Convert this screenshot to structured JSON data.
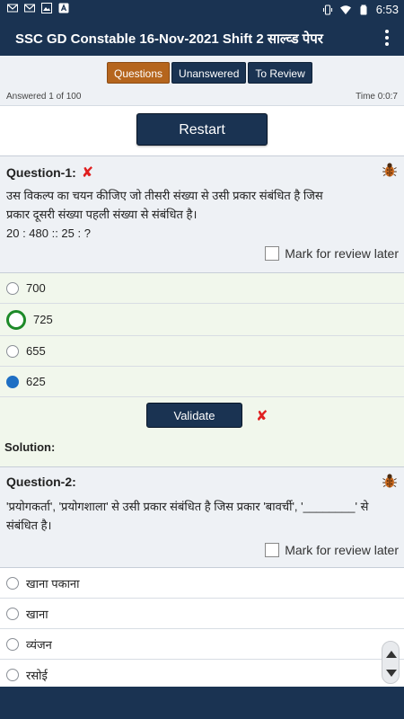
{
  "status_bar": {
    "time": "6:53",
    "left_icons": [
      "gmail-icon",
      "gmail-icon",
      "image-icon",
      "app-icon"
    ],
    "right_icons": [
      "vibrate-icon",
      "wifi-icon",
      "battery-icon"
    ]
  },
  "app_bar": {
    "title": "SSC GD Constable 16-Nov-2021 Shift 2 साल्व्ड पेपर",
    "menu_icon": "more-vert-icon"
  },
  "tabs": [
    {
      "label": "Questions",
      "active": true
    },
    {
      "label": "Unanswered",
      "active": false
    },
    {
      "label": "To Review",
      "active": false
    }
  ],
  "info": {
    "answered": "Answered 1 of 100",
    "time": "Time 0:0:7"
  },
  "restart_label": "Restart",
  "questions": [
    {
      "heading": "Question-1:",
      "text_line1": "उस विकल्प का चयन कीजिए जो तीसरी संख्या से उसी प्रकार संबंधित है जिस",
      "text_line2": "प्रकार दूसरी संख्या पहली संख्या से संबंधित है।",
      "text_line3": "20 : 480 :: 25 : ?",
      "mark_label": "Mark for review later",
      "options": [
        "700",
        "725",
        "655",
        "625"
      ],
      "validate_label": "Validate",
      "solution_label": "Solution:"
    },
    {
      "heading": "Question-2:",
      "text_line1": "'प्रयोगकर्ता', 'प्रयोगशाला' से उसी प्रकार संबंधित है जिस प्रकार 'बावर्ची', '________' से",
      "text_line2": "संबंधित है।",
      "mark_label": "Mark for review later",
      "options": [
        "खाना पकाना",
        "खाना",
        "व्यंजन",
        "रसोई"
      ]
    }
  ],
  "colors": {
    "primary": "#1a3352",
    "active_tab": "#b5651d",
    "panel_bg": "#eef1f5",
    "answer_bg": "#f1f7ec",
    "wrong": "#e02020",
    "correct": "#1d8a28",
    "selected": "#1e6fc4"
  }
}
